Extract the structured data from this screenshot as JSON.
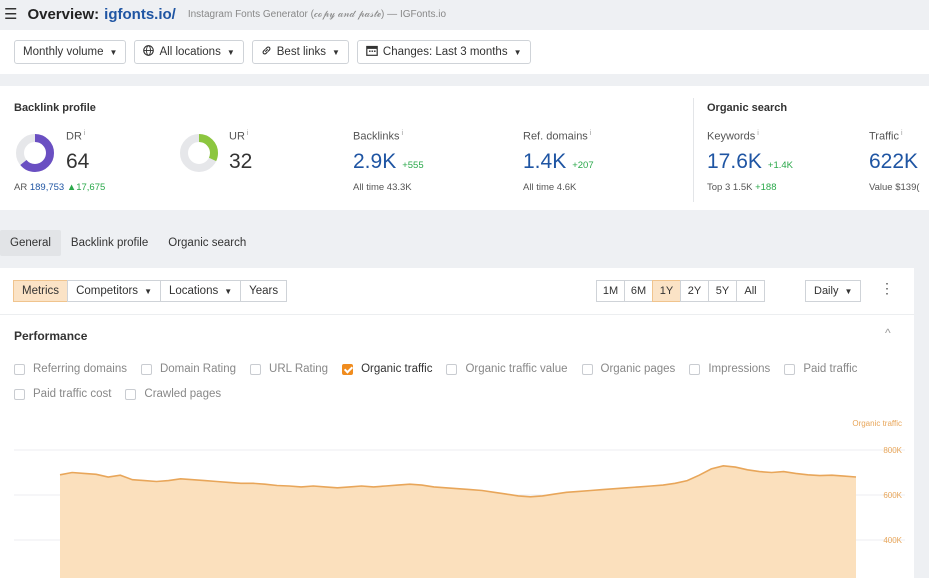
{
  "header": {
    "menu_icon": "hamburger-icon",
    "overview_label": "Overview:",
    "domain": "igfonts.io/",
    "description": "Instagram Fonts Generator (𝒸ℴ𝓅𝓎 𝒶𝓃𝒹 𝓅𝒶𝓈𝓉ℯ) — IGFonts.io"
  },
  "filters": {
    "volume": "Monthly volume",
    "locations": "All locations",
    "links": "Best links",
    "changes": "Changes: Last 3 months"
  },
  "backlink_profile": {
    "title": "Backlink profile",
    "dr_label": "DR",
    "dr_value": "64",
    "dr_fill": 0.64,
    "ar_label": "AR",
    "ar_value": "189,753",
    "ar_delta": "▲17,675",
    "ur_label": "UR",
    "ur_value": "32",
    "ur_fill": 0.32,
    "backlinks_label": "Backlinks",
    "backlinks_value": "2.9K",
    "backlinks_delta": "+555",
    "backlinks_alltime": "All time 43.3K",
    "refdomains_label": "Ref. domains",
    "refdomains_value": "1.4K",
    "refdomains_delta": "+207",
    "refdomains_alltime": "All time 4.6K"
  },
  "organic_search": {
    "title": "Organic search",
    "keywords_label": "Keywords",
    "keywords_value": "17.6K",
    "keywords_delta": "+1.4K",
    "top3_label": "Top 3",
    "top3_value": "1.5K",
    "top3_delta": "+188",
    "traffic_label": "Traffic",
    "traffic_value": "622K",
    "traffic_value_label": "Value $139("
  },
  "tabs": [
    "General",
    "Backlink profile",
    "Organic search"
  ],
  "toolbar": {
    "metrics": "Metrics",
    "competitors": "Competitors",
    "locations": "Locations",
    "years": "Years",
    "ranges": [
      "1M",
      "6M",
      "1Y",
      "2Y",
      "5Y",
      "All"
    ],
    "active_range": "1Y",
    "interval": "Daily"
  },
  "performance": {
    "title": "Performance",
    "checkboxes_row1": [
      "Referring domains",
      "Domain Rating",
      "URL Rating",
      "Organic traffic",
      "Organic traffic value",
      "Organic pages",
      "Impressions",
      "Paid traffic"
    ],
    "checkboxes_row2": [
      "Paid traffic cost",
      "Crawled pages"
    ],
    "checked": "Organic traffic"
  },
  "colors": {
    "accent_orange": "#f08c1e",
    "chart_line": "#e8a65a",
    "chart_fill": "#fbe0bd",
    "link_blue": "#1f55a3",
    "positive_green": "#2aa84a",
    "dr_purple": "#6a4fc2",
    "ur_green": "#8cc63f"
  },
  "chart_data": {
    "type": "area",
    "series": [
      {
        "name": "Organic traffic",
        "values": [
          690000,
          700000,
          696000,
          692000,
          680000,
          688000,
          668000,
          664000,
          660000,
          664000,
          672000,
          668000,
          664000,
          660000,
          656000,
          652000,
          652000,
          648000,
          642000,
          640000,
          636000,
          640000,
          636000,
          632000,
          636000,
          640000,
          636000,
          640000,
          644000,
          648000,
          644000,
          636000,
          632000,
          628000,
          624000,
          620000,
          612000,
          604000,
          596000,
          592000,
          596000,
          604000,
          612000,
          616000,
          620000,
          624000,
          628000,
          632000,
          636000,
          640000,
          644000,
          652000,
          664000,
          688000,
          716000,
          730000,
          724000,
          712000,
          704000,
          700000,
          704000,
          696000,
          690000,
          686000,
          688000,
          684000,
          680000
        ]
      }
    ],
    "ytick_labels": [
      "800K",
      "600K",
      "400K"
    ],
    "ylim": [
      300000,
      880000
    ],
    "grid": true,
    "legend": "Organic traffic"
  }
}
